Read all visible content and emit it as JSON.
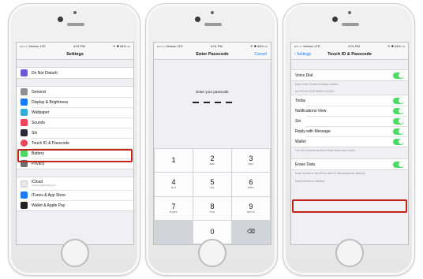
{
  "status": {
    "carrier": "••○○○ Verizon LTE",
    "time": "4:01 PM",
    "battery": "✈ ✱ 64% ▭"
  },
  "phone1": {
    "title": "Settings",
    "dnd": {
      "label": "Do Not Disturb",
      "color": "#6b5bd6"
    },
    "group2": [
      {
        "label": "General",
        "color": "#8e8e93"
      },
      {
        "label": "Display & Brightness",
        "color": "#1a7cf5"
      },
      {
        "label": "Wallpaper",
        "color": "#35aadc"
      },
      {
        "label": "Sounds",
        "color": "#f0445a"
      },
      {
        "label": "Siri",
        "color": "#2a2a3a"
      },
      {
        "label": "Touch ID & Passcode",
        "color": "#f0445a"
      },
      {
        "label": "Battery",
        "color": "#4cd964"
      },
      {
        "label": "Privacy",
        "color": "#6e6e73"
      }
    ],
    "group3": [
      {
        "label": "iCloud",
        "sub": "scottrmoir@icloud.com",
        "color": "#e8e8ed"
      },
      {
        "label": "iTunes & App Store",
        "color": "#1a7cf5"
      },
      {
        "label": "Wallet & Apple Pay",
        "color": "#222222"
      }
    ]
  },
  "phone2": {
    "title": "Enter Passcode",
    "cancel": "Cancel",
    "prompt": "Enter your passcode",
    "keys": [
      {
        "num": "1",
        "sub": ""
      },
      {
        "num": "2",
        "sub": "ABC"
      },
      {
        "num": "3",
        "sub": "DEF"
      },
      {
        "num": "4",
        "sub": "GHI"
      },
      {
        "num": "5",
        "sub": "JKL"
      },
      {
        "num": "6",
        "sub": "MNO"
      },
      {
        "num": "7",
        "sub": "PQRS"
      },
      {
        "num": "8",
        "sub": "TUV"
      },
      {
        "num": "9",
        "sub": "WXYZ"
      },
      {
        "num": "",
        "sub": ""
      },
      {
        "num": "0",
        "sub": ""
      },
      {
        "num": "⌫",
        "sub": ""
      }
    ]
  },
  "phone3": {
    "back": "Settings",
    "title": "Touch ID & Passcode",
    "voice_dial": "Voice Dial",
    "voice_note": "Music Voice Control is always enabled.",
    "section": "Allow access when locked:",
    "items": [
      "Today",
      "Notifications View",
      "Siri",
      "Reply with Message",
      "Wallet"
    ],
    "locked_note": "Turn off to prevent access to these items when locked.",
    "erase": "Erase Data",
    "erase_note": "Erase all data on this iPhone after 10 failed passcode attempts.",
    "protection_note": "Data protection is enabled."
  },
  "colors": {
    "highlight": "#c4231a",
    "toggle_on": "#4cd964",
    "ios_blue": "#1a7cf5"
  }
}
